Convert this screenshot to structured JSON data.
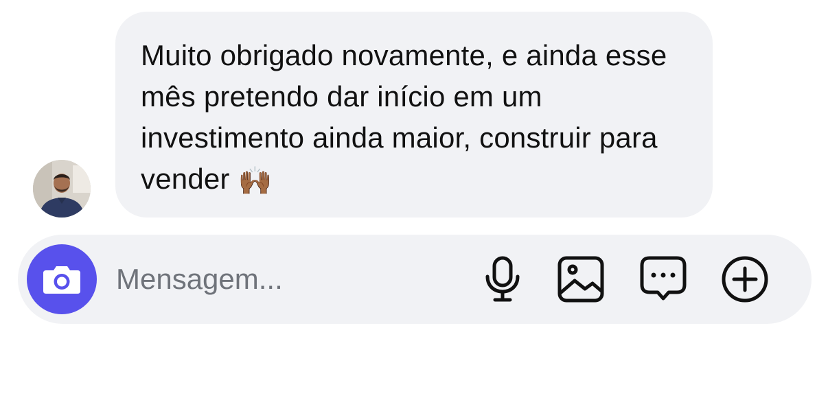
{
  "conversation": {
    "message": {
      "text": "Muito obrigado novamente, e ainda esse mês pretendo dar início em um investimento ainda maior, construir para vender",
      "emoji": "🙌🏾"
    },
    "sender": {
      "avatar_icon": "person-avatar"
    }
  },
  "composer": {
    "placeholder": "Mensagem...",
    "value": "",
    "accent_color": "#5851ec",
    "icons": [
      "camera-icon",
      "microphone-icon",
      "image-icon",
      "message-bubble-icon",
      "add-circle-icon"
    ]
  }
}
